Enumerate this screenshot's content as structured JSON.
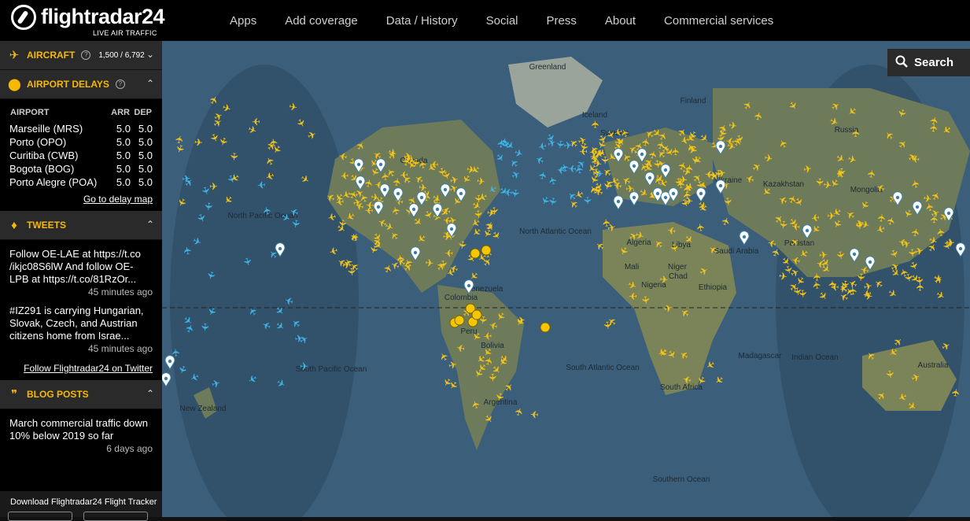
{
  "brand": {
    "name": "flightradar24",
    "tagline": "LIVE AIR TRAFFIC"
  },
  "nav": [
    "Apps",
    "Add coverage",
    "Data / History",
    "Social",
    "Press",
    "About",
    "Commercial services"
  ],
  "aircraft_panel": {
    "title": "AIRCRAFT",
    "count": "1,500 / 6,792"
  },
  "delays_panel": {
    "title": "AIRPORT DELAYS",
    "headers": {
      "airport": "AIRPORT",
      "arr": "ARR",
      "dep": "DEP"
    },
    "rows": [
      {
        "airport": "Marseille (MRS)",
        "arr": "5.0",
        "dep": "5.0"
      },
      {
        "airport": "Porto (OPO)",
        "arr": "5.0",
        "dep": "5.0"
      },
      {
        "airport": "Curitiba (CWB)",
        "arr": "5.0",
        "dep": "5.0"
      },
      {
        "airport": "Bogota (BOG)",
        "arr": "5.0",
        "dep": "5.0"
      },
      {
        "airport": "Porto Alegre (POA)",
        "arr": "5.0",
        "dep": "5.0"
      }
    ],
    "link": "Go to delay map"
  },
  "tweets_panel": {
    "title": "TWEETS",
    "items": [
      {
        "text": "Follow OE-LAE at https://t.co /ikjc08S6lW And follow OE-LPB at https://t.co/81RzOr...",
        "ago": "45 minutes ago"
      },
      {
        "text": "#IZ291 is carrying Hungarian, Slovak, Czech, and Austrian citizens home from Israe...",
        "ago": "45 minutes ago"
      }
    ],
    "link": "Follow Flightradar24 on Twitter"
  },
  "blog_panel": {
    "title": "BLOG POSTS",
    "items": [
      {
        "text": "March commercial traffic down 10% below 2019 so far",
        "ago": "6 days ago"
      }
    ]
  },
  "download": {
    "text": "Download Flightradar24 Flight Tracker"
  },
  "search": {
    "label": "Search"
  },
  "map_labels": [
    "Greenland",
    "Iceland",
    "Finland",
    "Sweden",
    "Russia",
    "Canada",
    "Ukraine",
    "Kazakhstan",
    "Mongolia",
    "North Pacific Ocean",
    "North Atlantic Ocean",
    "Algeria",
    "Libya",
    "Mali",
    "Niger",
    "Chad",
    "Nigeria",
    "Ethiopia",
    "Saudi Arabia",
    "Pakistan",
    "Venezuela",
    "Colombia",
    "Peru",
    "Bolivia",
    "Argentina",
    "South Pacific Ocean",
    "South Atlantic Ocean",
    "Madagascar",
    "Indian Ocean",
    "Australia",
    "New Zealand",
    "South Africa",
    "Southern Ocean"
  ],
  "colors": {
    "accent": "#f6b800",
    "plane_yellow": "#f5c518",
    "plane_blue": "#3fb6e8",
    "ocean": "#3b5e7a",
    "land": "#6d7b5a"
  }
}
